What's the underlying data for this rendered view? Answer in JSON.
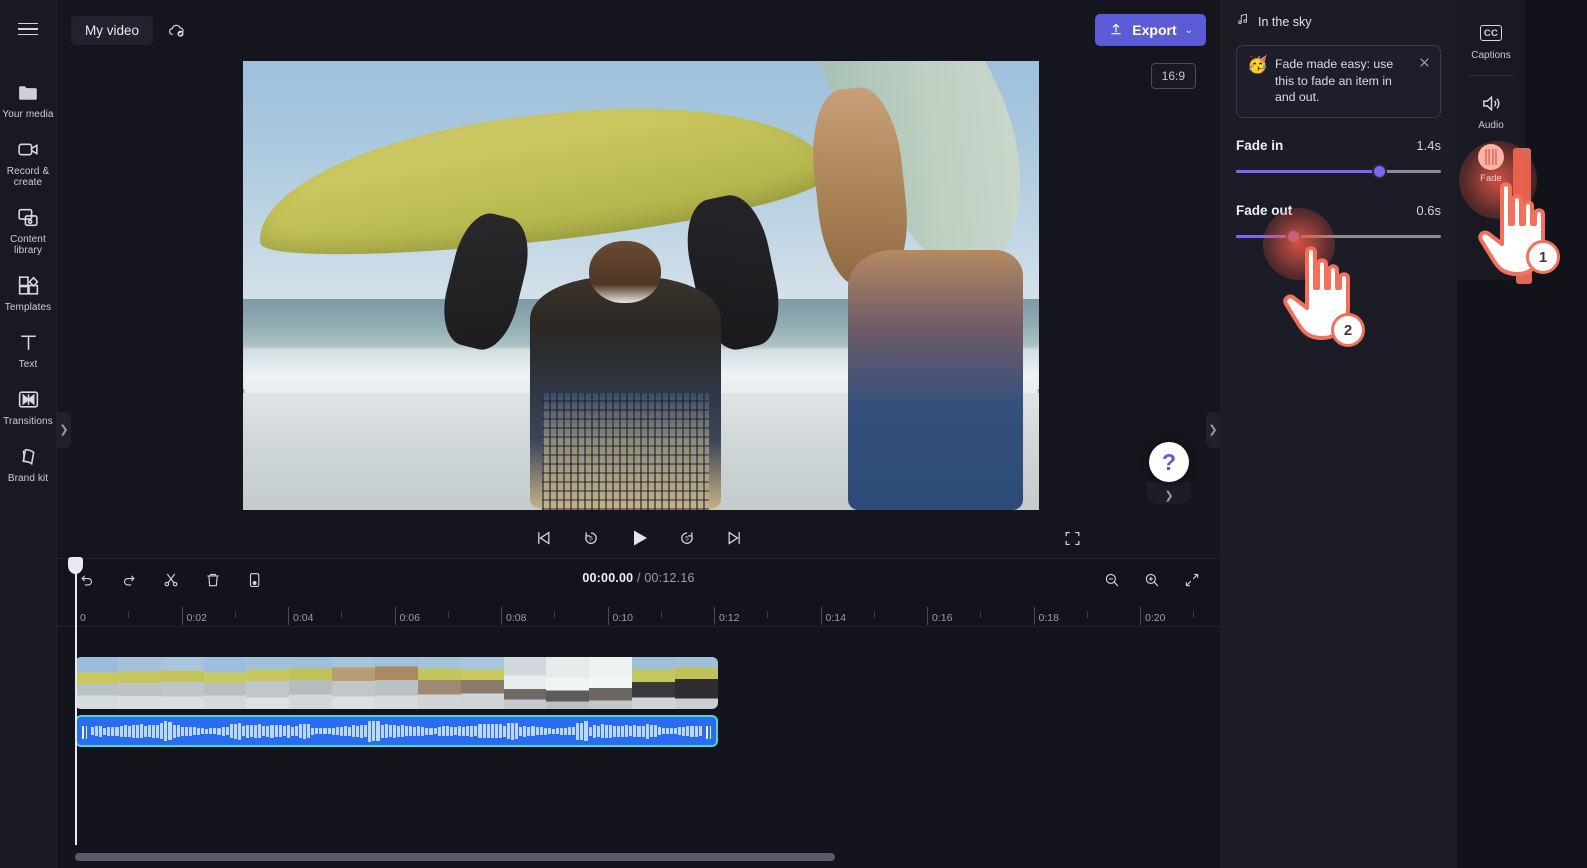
{
  "app": {
    "project_title": "My video",
    "saved_icon": "cloud-check-icon",
    "export_label": "Export",
    "export_chevron": "⌄",
    "aspect_ratio": "16:9",
    "help_glyph": "?"
  },
  "left_rail": {
    "menu_icon": "hamburger-icon",
    "items": [
      {
        "label": "Your media",
        "icon": "folder-icon"
      },
      {
        "label": "Record & create",
        "icon": "video-camera-icon"
      },
      {
        "label": "Content library",
        "icon": "content-library-icon"
      },
      {
        "label": "Templates",
        "icon": "templates-icon"
      },
      {
        "label": "Text",
        "icon": "text-icon"
      },
      {
        "label": "Transitions",
        "icon": "transitions-icon"
      },
      {
        "label": "Brand kit",
        "icon": "brand-kit-icon"
      }
    ]
  },
  "player": {
    "controls": [
      {
        "name": "skip-to-start-button",
        "icon": "skip-previous-icon"
      },
      {
        "name": "rewind-5s-button",
        "icon": "replay-5-icon"
      },
      {
        "name": "play-button",
        "icon": "play-icon"
      },
      {
        "name": "forward-5s-button",
        "icon": "forward-5-icon"
      },
      {
        "name": "skip-to-end-button",
        "icon": "skip-next-icon"
      }
    ],
    "fullscreen_icon": "fullscreen-icon"
  },
  "timeline": {
    "current_time": "00:00.00",
    "separator": " / ",
    "total_time": "00:12.16",
    "tools": [
      {
        "name": "undo-button",
        "icon": "undo-icon"
      },
      {
        "name": "redo-button",
        "icon": "redo-icon"
      },
      {
        "name": "split-button",
        "icon": "scissors-icon"
      },
      {
        "name": "delete-button",
        "icon": "trash-icon"
      },
      {
        "name": "duplicate-button",
        "icon": "duplicate-icon"
      }
    ],
    "zoom_tools": [
      {
        "name": "zoom-out-button",
        "icon": "zoom-out-icon"
      },
      {
        "name": "zoom-in-button",
        "icon": "zoom-in-icon"
      },
      {
        "name": "fit-to-screen-button",
        "icon": "fit-screen-icon"
      }
    ],
    "ruler_labels": [
      "0",
      "0:02",
      "0:04",
      "0:06",
      "0:08",
      "0:10",
      "0:12",
      "0:14",
      "0:16",
      "0:18",
      "0:20"
    ],
    "video_clip_name": "video-clip",
    "audio_clip_name": "audio-clip-in-the-sky"
  },
  "properties": {
    "header_icon": "music-note-icon",
    "header_label": "In the sky",
    "tip": {
      "emoji": "🥳",
      "text": "Fade made easy: use this to fade an item in and out.",
      "close_icon": "close-icon"
    },
    "fade_in": {
      "label": "Fade in",
      "value": "1.4s",
      "percent": 70
    },
    "fade_out": {
      "label": "Fade out",
      "value": "0.6s",
      "percent": 28
    }
  },
  "right_rail": {
    "items": [
      {
        "label": "Captions",
        "icon": "closed-captions-icon"
      },
      {
        "label": "Audio",
        "icon": "speaker-icon"
      }
    ],
    "fade_item": {
      "label": "Fade",
      "icon": "fade-icon"
    }
  },
  "annotations": {
    "step_one": "1",
    "step_two": "2",
    "accent_color": "#f2705c"
  },
  "colors": {
    "accent_purple": "#5b5bd6",
    "slider_purple": "#7b68ee",
    "audio_clip": "#2a6cf0",
    "audio_selected_border": "#4fd6c8",
    "panel_bg": "#1c1c27",
    "app_bg": "#15151e"
  }
}
